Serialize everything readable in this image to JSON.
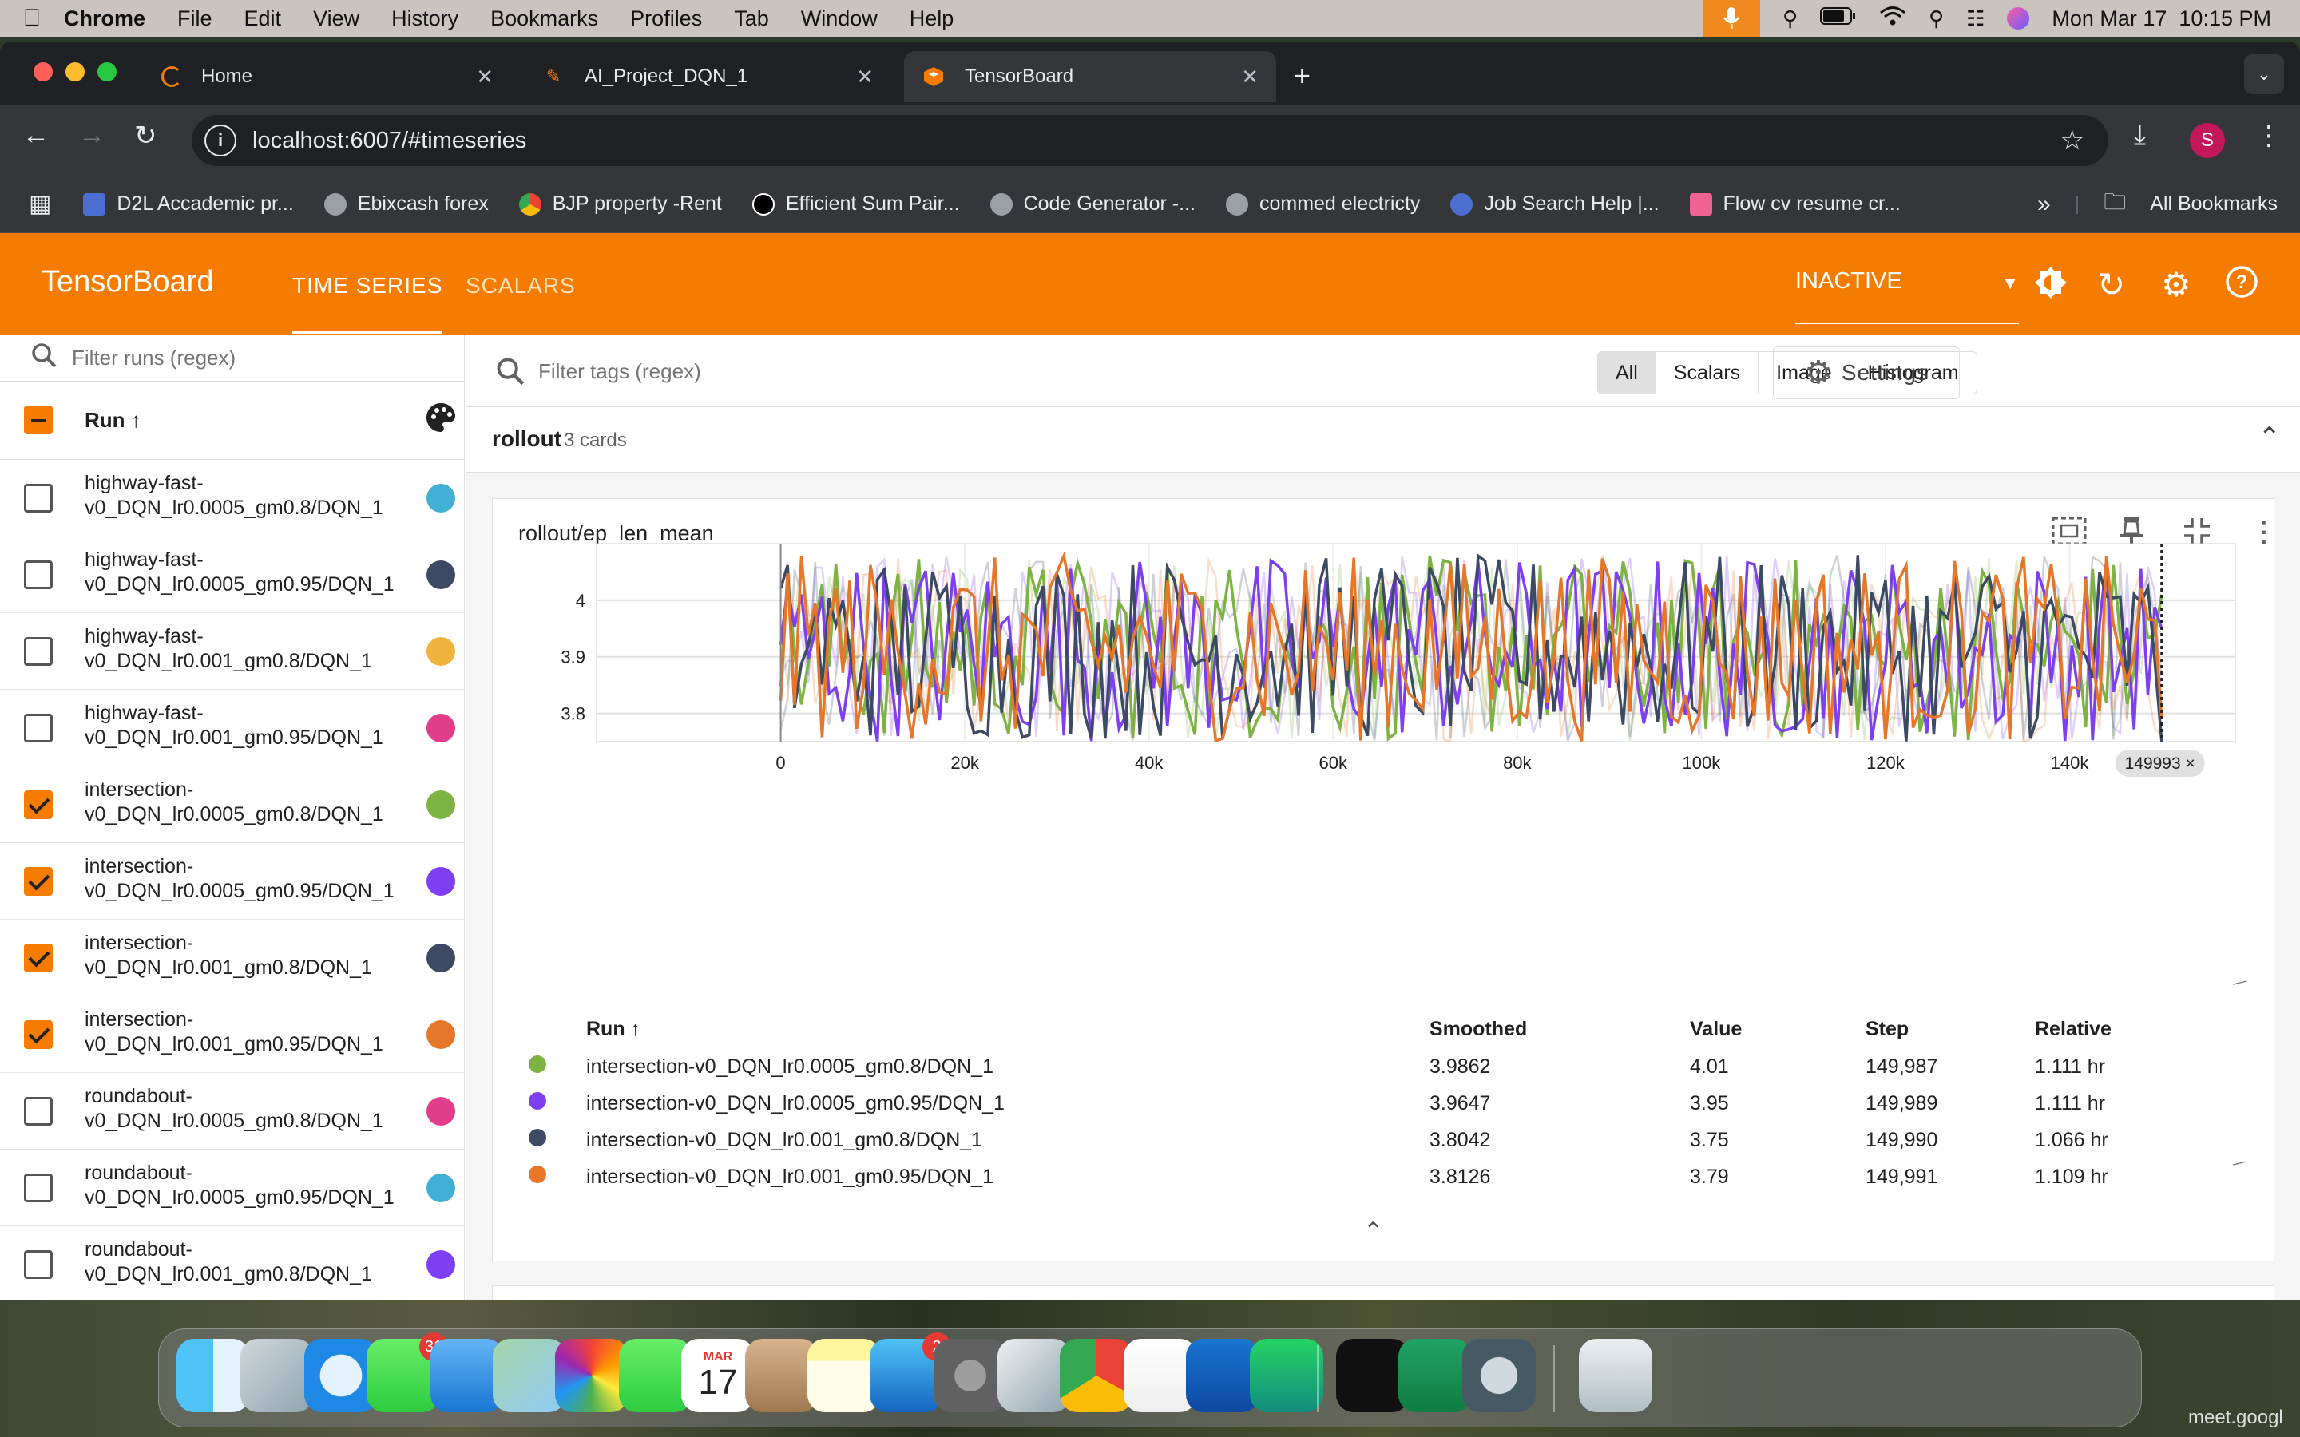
{
  "menubar": {
    "app": "Chrome",
    "items": [
      "File",
      "Edit",
      "View",
      "History",
      "Bookmarks",
      "Profiles",
      "Tab",
      "Window",
      "Help"
    ],
    "datetime": "Mon Mar 17  10:15 PM"
  },
  "tabs": [
    {
      "title": "Home"
    },
    {
      "title": "AI_Project_DQN_1"
    },
    {
      "title": "TensorBoard"
    }
  ],
  "url": "localhost:6007/#timeseries",
  "profile_initial": "S",
  "bookmarks": [
    "D2L Accademic pr...",
    "Ebixcash forex",
    "BJP property -Rent",
    "Efficient Sum Pair...",
    "Code Generator -...",
    "commed electricty",
    "Job Search Help |...",
    "Flow cv resume cr..."
  ],
  "bookmarks_all": "All Bookmarks",
  "tensorboard": {
    "brand": "TensorBoard",
    "nav": [
      "TIME SERIES",
      "SCALARS"
    ],
    "status": "INACTIVE",
    "filter_runs_placeholder": "Filter runs (regex)",
    "run_header": "Run ↑",
    "runs": [
      {
        "line1": "highway-fast-",
        "line2": "v0_DQN_lr0.0005_gm0.8/DQN_1",
        "checked": false,
        "color": "#42b0d4"
      },
      {
        "line1": "highway-fast-",
        "line2": "v0_DQN_lr0.0005_gm0.95/DQN_1",
        "checked": false,
        "color": "#3d4a63"
      },
      {
        "line1": "highway-fast-",
        "line2": "v0_DQN_lr0.001_gm0.8/DQN_1",
        "checked": false,
        "color": "#f2b33d"
      },
      {
        "line1": "highway-fast-",
        "line2": "v0_DQN_lr0.001_gm0.95/DQN_1",
        "checked": false,
        "color": "#e23d8a"
      },
      {
        "line1": "intersection-",
        "line2": "v0_DQN_lr0.0005_gm0.8/DQN_1",
        "checked": true,
        "color": "#7cb342"
      },
      {
        "line1": "intersection-",
        "line2": "v0_DQN_lr0.0005_gm0.95/DQN_1",
        "checked": true,
        "color": "#7e3ff2"
      },
      {
        "line1": "intersection-",
        "line2": "v0_DQN_lr0.001_gm0.8/DQN_1",
        "checked": true,
        "color": "#3d4a63"
      },
      {
        "line1": "intersection-",
        "line2": "v0_DQN_lr0.001_gm0.95/DQN_1",
        "checked": true,
        "color": "#e6762a"
      },
      {
        "line1": "roundabout-",
        "line2": "v0_DQN_lr0.0005_gm0.8/DQN_1",
        "checked": false,
        "color": "#e23d8a"
      },
      {
        "line1": "roundabout-",
        "line2": "v0_DQN_lr0.0005_gm0.95/DQN_1",
        "checked": false,
        "color": "#42b0d4"
      },
      {
        "line1": "roundabout-",
        "line2": "v0_DQN_lr0.001_gm0.8/DQN_1",
        "checked": false,
        "color": "#7e3ff2"
      }
    ],
    "filter_tags_placeholder": "Filter tags (regex)",
    "type_filters": [
      "All",
      "Scalars",
      "Image",
      "Histogram"
    ],
    "settings_label": "Settings",
    "group": {
      "name": "rollout",
      "count": "3 cards"
    },
    "card_title": "rollout/ep_len_mean",
    "step_chip": "149993 ×",
    "legend_headers": [
      "Run ↑",
      "Smoothed",
      "Value",
      "Step",
      "Relative"
    ],
    "legend_rows": [
      {
        "run": "intersection-v0_DQN_lr0.0005_gm0.8/DQN_1",
        "smoothed": "3.9862",
        "value": "4.01",
        "step": "149,987",
        "relative": "1.111 hr",
        "color": "#7cb342"
      },
      {
        "run": "intersection-v0_DQN_lr0.0005_gm0.95/DQN_1",
        "smoothed": "3.9647",
        "value": "3.95",
        "step": "149,989",
        "relative": "1.111 hr",
        "color": "#7e3ff2"
      },
      {
        "run": "intersection-v0_DQN_lr0.001_gm0.8/DQN_1",
        "smoothed": "3.8042",
        "value": "3.75",
        "step": "149,990",
        "relative": "1.066 hr",
        "color": "#3d4a63"
      },
      {
        "run": "intersection-v0_DQN_lr0.001_gm0.95/DQN_1",
        "smoothed": "3.8126",
        "value": "3.79",
        "step": "149,991",
        "relative": "1.109 hr",
        "color": "#e6762a"
      }
    ]
  },
  "chart_data": {
    "type": "line",
    "title": "rollout/ep_len_mean",
    "xlabel": "",
    "ylabel": "",
    "x_ticks": [
      "0",
      "20k",
      "40k",
      "60k",
      "80k",
      "100k",
      "120k",
      "140k"
    ],
    "y_ticks": [
      "3.8",
      "3.9",
      "4"
    ],
    "xlim": [
      -20000,
      158000
    ],
    "ylim": [
      3.75,
      4.1
    ],
    "x_range_data": [
      0,
      150000
    ],
    "series": [
      {
        "name": "intersection-v0_DQN_lr0.0005_gm0.8/DQN_1",
        "color": "#7cb342",
        "last_value": 4.01
      },
      {
        "name": "intersection-v0_DQN_lr0.0005_gm0.95/DQN_1",
        "color": "#7e3ff2",
        "last_value": 3.95
      },
      {
        "name": "intersection-v0_DQN_lr0.001_gm0.8/DQN_1",
        "color": "#3d4a63",
        "last_value": 3.75
      },
      {
        "name": "intersection-v0_DQN_lr0.001_gm0.95/DQN_1",
        "color": "#e6762a",
        "last_value": 3.79
      }
    ]
  },
  "dock": [
    {
      "name": "Finder",
      "icon": "finder-icon"
    },
    {
      "name": "Launchpad",
      "icon": "launchpad-icon"
    },
    {
      "name": "Safari",
      "icon": "safari-icon"
    },
    {
      "name": "Messages",
      "icon": "messages-icon",
      "badge": "31"
    },
    {
      "name": "Mail",
      "icon": "mail-icon"
    },
    {
      "name": "Maps",
      "icon": "maps-icon"
    },
    {
      "name": "Photos",
      "icon": "photos-icon"
    },
    {
      "name": "FaceTime",
      "icon": "facetime-icon"
    },
    {
      "name": "Calendar",
      "icon": "calendar-icon",
      "month": "MAR",
      "day": "17"
    },
    {
      "name": "Contacts",
      "icon": "contacts-icon"
    },
    {
      "name": "Notes",
      "icon": "notes-icon"
    },
    {
      "name": "App Store",
      "icon": "appstore-icon",
      "badge": "2"
    },
    {
      "name": "System Settings",
      "icon": "settings-icon"
    },
    {
      "name": "iPhone Mirroring",
      "icon": "iphone-icon"
    },
    {
      "name": "Chrome",
      "icon": "chrome-icon"
    },
    {
      "name": "VS Code",
      "icon": "vscode-icon"
    },
    {
      "name": "Outlook",
      "icon": "outlook-icon"
    },
    {
      "name": "WhatsApp",
      "icon": "whatsapp-icon"
    },
    {
      "name": "Terminal",
      "icon": "terminal-icon"
    },
    {
      "name": "Excel",
      "icon": "excel-icon"
    },
    {
      "name": "QuickTime",
      "icon": "quicktime-icon"
    },
    {
      "name": "Trash",
      "icon": "trash-icon"
    }
  ],
  "meet_label": "meet.googl"
}
